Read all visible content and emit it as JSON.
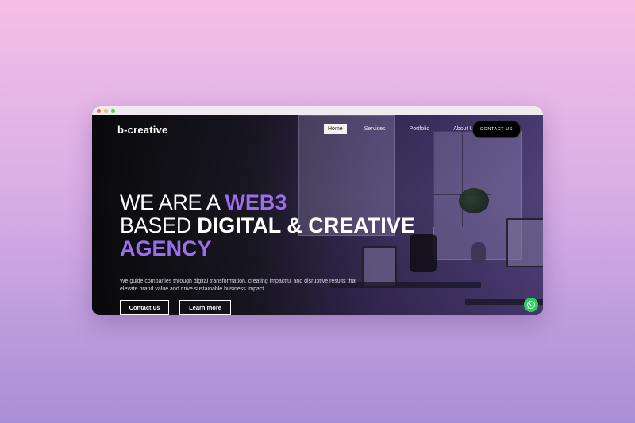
{
  "window": {
    "dot_colors": [
      "#ec6a5f",
      "#f4bf4f",
      "#61c554"
    ]
  },
  "site": {
    "logo": "b-creative"
  },
  "nav": {
    "items": [
      {
        "label": "Home",
        "active": true
      },
      {
        "label": "Services",
        "active": false
      },
      {
        "label": "Portfolio",
        "active": false
      },
      {
        "label": "About Us",
        "active": false
      }
    ],
    "cta": "CONTACT US"
  },
  "hero": {
    "line1_thin": "WE ARE A ",
    "line1_accent": "WEB3",
    "line2_thin": "BASED ",
    "line2_bold": "DIGITAL & CREATIVE",
    "line3_accent": "AGENCY",
    "description": "We guide companies through digital transformation, creating impactful and disruptive results that elevate brand value and drive sustainable business impact.",
    "buttons": {
      "primary": "Contact us",
      "secondary": "Learn more"
    }
  },
  "colors": {
    "accent": "#9b6ef0",
    "whatsapp": "#2ccf5a"
  },
  "icons": {
    "whatsapp": "whatsapp-icon"
  }
}
